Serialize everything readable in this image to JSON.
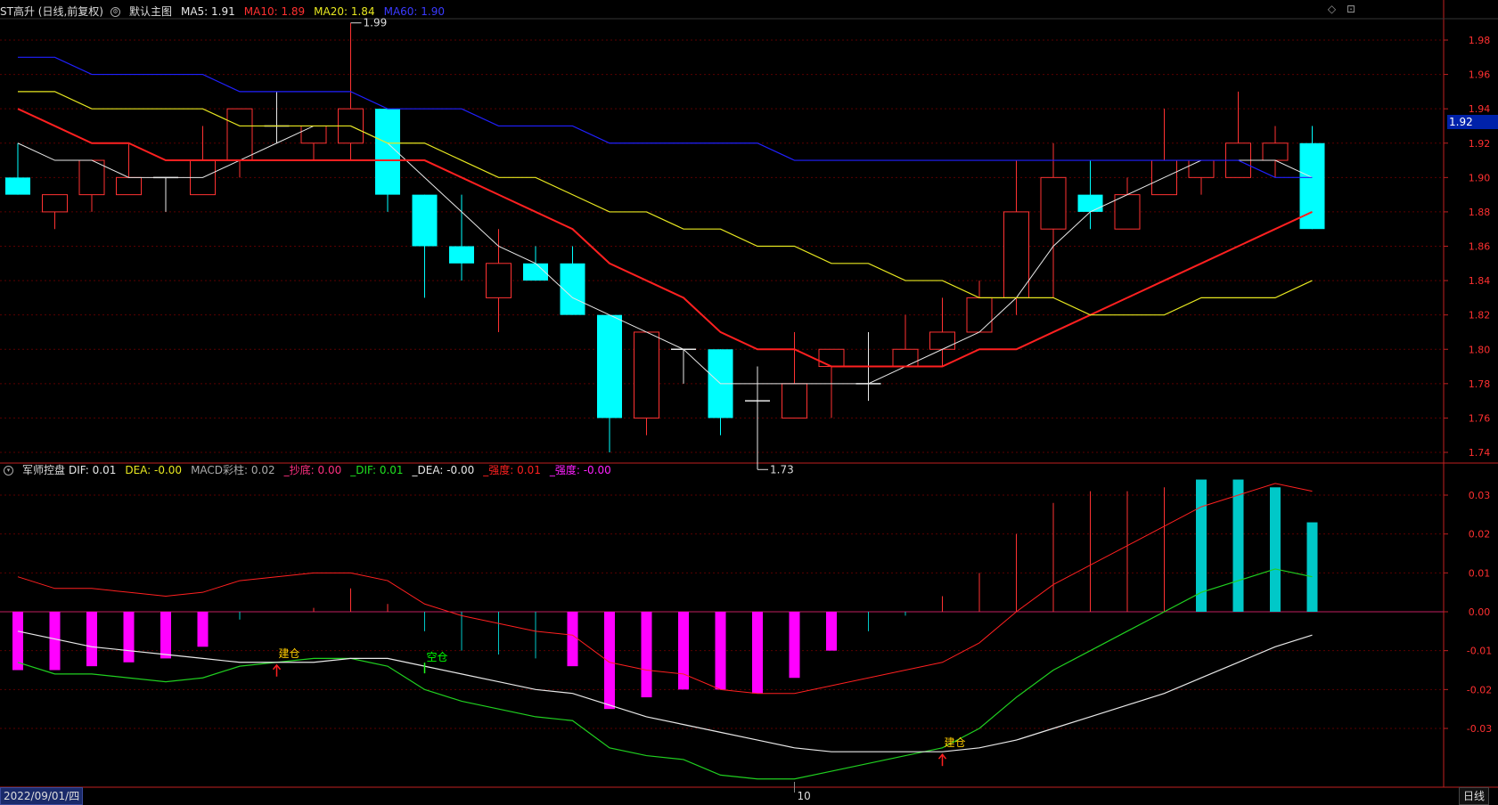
{
  "header_main": {
    "ticker": "ST高升 (日线,前复权)",
    "chart_name": "默认主图",
    "ma5": "MA5: 1.91",
    "ma10": "MA10: 1.89",
    "ma20": "MA20: 1.84",
    "ma60": "MA60: 1.90"
  },
  "header_sub": {
    "indicator": "军师控盘",
    "dif": "DIF: 0.01",
    "dea": "DEA: -0.00",
    "macd": "MACD彩柱: 0.02",
    "chaodi": "_抄底: 0.00",
    "dif2": "_DIF: 0.01",
    "dea2": "_DEA: -0.00",
    "qiangdu1": "_强度: 0.01",
    "qiangdu2": "_强度: -0.00"
  },
  "top_icons": [
    "diamond-icon",
    "maximize-icon"
  ],
  "current_price": "1.92",
  "date_label": "2022/09/01/四",
  "period_label": "日线",
  "month_marker": "10",
  "colors": {
    "up": "#ff3232",
    "down": "#00ffff",
    "ma5": "#e8e8e8",
    "ma10": "#ff2020",
    "ma20": "#e8e820",
    "ma60": "#2020ff",
    "grid": "#5a0000",
    "axis": "#c02020",
    "macd_pos": "#00c8c8",
    "macd_neg": "#ff00ff",
    "dif": "#e8e8e8",
    "dea": "#ff2020"
  },
  "chart_data": [
    {
      "type": "candlestick",
      "title": "ST高升 (日线,前复权)",
      "ylim": [
        1.73,
        2.0
      ],
      "yticks": [
        "1.98",
        "1.96",
        "1.94",
        "1.92",
        "1.90",
        "1.88",
        "1.86",
        "1.84",
        "1.82",
        "1.80",
        "1.78",
        "1.76",
        "1.74"
      ],
      "yticks_values": [
        1.98,
        1.96,
        1.94,
        1.92,
        1.9,
        1.88,
        1.86,
        1.84,
        1.82,
        1.8,
        1.78,
        1.76,
        1.74
      ],
      "annotations": [
        {
          "label": "1.99",
          "index": 9,
          "value": 1.99
        },
        {
          "label": "1.73",
          "index": 20,
          "value": 1.73
        }
      ],
      "candles": [
        {
          "o": 1.9,
          "h": 1.92,
          "l": 1.89,
          "c": 1.89
        },
        {
          "o": 1.88,
          "h": 1.89,
          "l": 1.87,
          "c": 1.89
        },
        {
          "o": 1.89,
          "h": 1.91,
          "l": 1.88,
          "c": 1.91
        },
        {
          "o": 1.89,
          "h": 1.92,
          "l": 1.89,
          "c": 1.9
        },
        {
          "o": 1.9,
          "h": 1.9,
          "l": 1.88,
          "c": 1.9
        },
        {
          "o": 1.89,
          "h": 1.93,
          "l": 1.89,
          "c": 1.91
        },
        {
          "o": 1.91,
          "h": 1.94,
          "l": 1.9,
          "c": 1.94
        },
        {
          "o": 1.93,
          "h": 1.95,
          "l": 1.92,
          "c": 1.93
        },
        {
          "o": 1.92,
          "h": 1.93,
          "l": 1.91,
          "c": 1.93
        },
        {
          "o": 1.92,
          "h": 1.99,
          "l": 1.91,
          "c": 1.94
        },
        {
          "o": 1.94,
          "h": 1.94,
          "l": 1.88,
          "c": 1.89
        },
        {
          "o": 1.89,
          "h": 1.89,
          "l": 1.83,
          "c": 1.86
        },
        {
          "o": 1.86,
          "h": 1.89,
          "l": 1.84,
          "c": 1.85
        },
        {
          "o": 1.83,
          "h": 1.87,
          "l": 1.81,
          "c": 1.85
        },
        {
          "o": 1.85,
          "h": 1.86,
          "l": 1.84,
          "c": 1.84
        },
        {
          "o": 1.85,
          "h": 1.86,
          "l": 1.82,
          "c": 1.82
        },
        {
          "o": 1.82,
          "h": 1.82,
          "l": 1.74,
          "c": 1.76
        },
        {
          "o": 1.76,
          "h": 1.81,
          "l": 1.75,
          "c": 1.81
        },
        {
          "o": 1.8,
          "h": 1.8,
          "l": 1.78,
          "c": 1.8
        },
        {
          "o": 1.8,
          "h": 1.8,
          "l": 1.75,
          "c": 1.76
        },
        {
          "o": 1.77,
          "h": 1.79,
          "l": 1.73,
          "c": 1.77
        },
        {
          "o": 1.76,
          "h": 1.81,
          "l": 1.76,
          "c": 1.78
        },
        {
          "o": 1.79,
          "h": 1.8,
          "l": 1.76,
          "c": 1.8
        },
        {
          "o": 1.78,
          "h": 1.81,
          "l": 1.77,
          "c": 1.78
        },
        {
          "o": 1.79,
          "h": 1.82,
          "l": 1.79,
          "c": 1.8
        },
        {
          "o": 1.8,
          "h": 1.83,
          "l": 1.79,
          "c": 1.81
        },
        {
          "o": 1.81,
          "h": 1.84,
          "l": 1.81,
          "c": 1.83
        },
        {
          "o": 1.83,
          "h": 1.91,
          "l": 1.82,
          "c": 1.88
        },
        {
          "o": 1.87,
          "h": 1.92,
          "l": 1.83,
          "c": 1.9
        },
        {
          "o": 1.89,
          "h": 1.91,
          "l": 1.87,
          "c": 1.88
        },
        {
          "o": 1.87,
          "h": 1.9,
          "l": 1.87,
          "c": 1.89
        },
        {
          "o": 1.89,
          "h": 1.94,
          "l": 1.89,
          "c": 1.91
        },
        {
          "o": 1.9,
          "h": 1.91,
          "l": 1.89,
          "c": 1.91
        },
        {
          "o": 1.9,
          "h": 1.95,
          "l": 1.9,
          "c": 1.92
        },
        {
          "o": 1.91,
          "h": 1.93,
          "l": 1.9,
          "c": 1.92
        },
        {
          "o": 1.92,
          "h": 1.93,
          "l": 1.87,
          "c": 1.87
        }
      ],
      "ma": [
        {
          "name": "MA5",
          "values": [
            1.92,
            1.91,
            1.91,
            1.9,
            1.9,
            1.9,
            1.91,
            1.92,
            1.93,
            1.93,
            1.92,
            1.9,
            1.88,
            1.86,
            1.85,
            1.83,
            1.82,
            1.81,
            1.8,
            1.78,
            1.78,
            1.78,
            1.78,
            1.78,
            1.79,
            1.8,
            1.81,
            1.83,
            1.86,
            1.88,
            1.89,
            1.9,
            1.91,
            1.91,
            1.91,
            1.9
          ]
        },
        {
          "name": "MA10",
          "values": [
            1.94,
            1.93,
            1.92,
            1.92,
            1.91,
            1.91,
            1.91,
            1.91,
            1.91,
            1.91,
            1.91,
            1.91,
            1.9,
            1.89,
            1.88,
            1.87,
            1.85,
            1.84,
            1.83,
            1.81,
            1.8,
            1.8,
            1.79,
            1.79,
            1.79,
            1.79,
            1.8,
            1.8,
            1.81,
            1.82,
            1.83,
            1.84,
            1.85,
            1.86,
            1.87,
            1.88
          ]
        },
        {
          "name": "MA20",
          "values": [
            1.95,
            1.95,
            1.94,
            1.94,
            1.94,
            1.94,
            1.93,
            1.93,
            1.93,
            1.93,
            1.92,
            1.92,
            1.91,
            1.9,
            1.9,
            1.89,
            1.88,
            1.88,
            1.87,
            1.87,
            1.86,
            1.86,
            1.85,
            1.85,
            1.84,
            1.84,
            1.83,
            1.83,
            1.83,
            1.82,
            1.82,
            1.82,
            1.83,
            1.83,
            1.83,
            1.84
          ]
        },
        {
          "name": "MA60",
          "values": [
            1.97,
            1.97,
            1.96,
            1.96,
            1.96,
            1.96,
            1.95,
            1.95,
            1.95,
            1.95,
            1.94,
            1.94,
            1.94,
            1.93,
            1.93,
            1.93,
            1.92,
            1.92,
            1.92,
            1.92,
            1.92,
            1.91,
            1.91,
            1.91,
            1.91,
            1.91,
            1.91,
            1.91,
            1.91,
            1.91,
            1.91,
            1.91,
            1.91,
            1.91,
            1.9,
            1.9
          ]
        }
      ]
    },
    {
      "type": "bar",
      "title": "军师控盘",
      "ylim": [
        -0.045,
        0.037
      ],
      "yticks": [
        "0.03",
        "0.02",
        "0.01",
        "0.00",
        "-0.01",
        "-0.02",
        "-0.03"
      ],
      "yticks_values": [
        0.03,
        0.02,
        0.01,
        0.0,
        -0.01,
        -0.02,
        -0.03
      ],
      "macd": [
        -0.015,
        -0.015,
        -0.014,
        -0.013,
        -0.012,
        -0.009,
        -0.002,
        0.0,
        0.001,
        0.006,
        0.002,
        -0.005,
        -0.01,
        -0.011,
        -0.012,
        -0.014,
        -0.025,
        -0.022,
        -0.02,
        -0.02,
        -0.021,
        -0.017,
        -0.01,
        -0.005,
        -0.001,
        0.004,
        0.01,
        0.02,
        0.028,
        0.031,
        0.031,
        0.032,
        0.034,
        0.034,
        0.032,
        0.023
      ],
      "dif": [
        -0.013,
        -0.016,
        -0.016,
        -0.017,
        -0.018,
        -0.017,
        -0.014,
        -0.013,
        -0.012,
        -0.012,
        -0.014,
        -0.02,
        -0.023,
        -0.025,
        -0.027,
        -0.028,
        -0.035,
        -0.037,
        -0.038,
        -0.042,
        -0.043,
        -0.043,
        -0.041,
        -0.039,
        -0.037,
        -0.035,
        -0.03,
        -0.022,
        -0.015,
        -0.01,
        -0.005,
        0.0,
        0.005,
        0.008,
        0.011,
        0.009
      ],
      "dea": [
        -0.005,
        -0.007,
        -0.009,
        -0.01,
        -0.011,
        -0.012,
        -0.013,
        -0.013,
        -0.013,
        -0.012,
        -0.012,
        -0.014,
        -0.016,
        -0.018,
        -0.02,
        -0.021,
        -0.024,
        -0.027,
        -0.029,
        -0.031,
        -0.033,
        -0.035,
        -0.036,
        -0.036,
        -0.036,
        -0.036,
        -0.035,
        -0.033,
        -0.03,
        -0.027,
        -0.024,
        -0.021,
        -0.017,
        -0.013,
        -0.009,
        -0.006
      ],
      "signals": [
        {
          "label": "建仓",
          "index": 7,
          "color": "#ffcc00"
        },
        {
          "label": "空仓",
          "index": 11,
          "color": "#00ff00"
        },
        {
          "label": "建仓",
          "index": 25,
          "color": "#ffcc00"
        }
      ]
    }
  ]
}
